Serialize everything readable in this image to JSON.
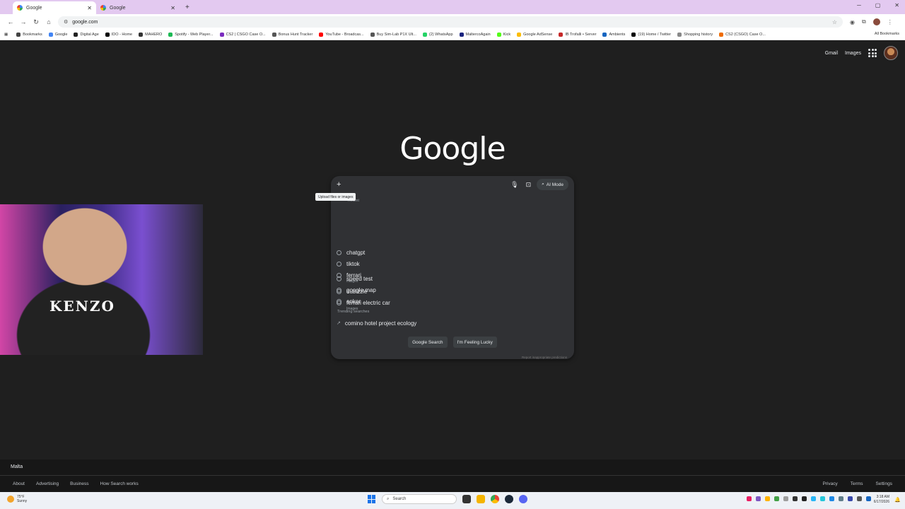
{
  "browser": {
    "tabs": [
      {
        "title": "Google",
        "active": true
      },
      {
        "title": "Google",
        "active": false
      }
    ],
    "url": "google.com",
    "bookmarks": [
      {
        "label": "Bookmarks",
        "color": "#444"
      },
      {
        "label": "Google",
        "color": "#4285f4"
      },
      {
        "label": "Digital Age",
        "color": "#222"
      },
      {
        "label": "IDO - Home",
        "color": "#000"
      },
      {
        "label": "MAHERO",
        "color": "#333"
      },
      {
        "label": "Spotify - Web Player...",
        "color": "#1db954"
      },
      {
        "label": "CS2 | CSGO Case O...",
        "color": "#7b2cbf"
      },
      {
        "label": "Bonus Hunt Tracker",
        "color": "#555"
      },
      {
        "label": "YouTube - Broadcas...",
        "color": "#ff0000"
      },
      {
        "label": "Buy Sim-Lab P1X Ult...",
        "color": "#555"
      },
      {
        "label": "(2) WhatsApp",
        "color": "#25d366"
      },
      {
        "label": "MaltercoAgain",
        "color": "#1a237e"
      },
      {
        "label": "Kick",
        "color": "#53fc18"
      },
      {
        "label": "Google AdSense",
        "color": "#fbbc05"
      },
      {
        "label": "IB Trofalli • Server",
        "color": "#c62828"
      },
      {
        "label": "Ambients",
        "color": "#1565c0"
      },
      {
        "label": "(19) Home / Twitter",
        "color": "#000"
      },
      {
        "label": "Shopping history",
        "color": "#888"
      },
      {
        "label": "CS2 (CSGO) Case O...",
        "color": "#ef6c00"
      }
    ],
    "all_bookmarks": "All Bookmarks"
  },
  "google": {
    "header_links": {
      "gmail": "Gmail",
      "images": "Images"
    },
    "logo": "Google",
    "search": {
      "value": "",
      "placeholder": ""
    },
    "ai_mode": "AI Mode",
    "tooltip": "Upload files or images",
    "recent_heading": "Recent",
    "suggestions": [
      {
        "text": "chatgpt",
        "sub": ""
      },
      {
        "text": "tiktok",
        "sub": ""
      },
      {
        "text": "ferrari",
        "sub": "Images"
      },
      {
        "text": "dubizzle",
        "sub": ""
      },
      {
        "text": "ferrari electric car",
        "sub": "Images"
      },
      {
        "text": "speed test",
        "sub": ""
      },
      {
        "text": "google map",
        "sub": ""
      },
      {
        "text": "anker",
        "sub": ""
      }
    ],
    "trending_heading": "Trending searches",
    "trending": [
      {
        "text": "comino hotel project ecology"
      }
    ],
    "buttons": {
      "search": "Google Search",
      "lucky": "I'm Feeling Lucky"
    },
    "report": "Report inappropriate predictions"
  },
  "webcam": {
    "shirt_text": "KENZO"
  },
  "footer": {
    "country": "Malta",
    "left_links": [
      "About",
      "Advertising",
      "Business",
      "How Search works"
    ],
    "right_links": [
      "Privacy",
      "Terms",
      "Settings"
    ]
  },
  "taskbar": {
    "weather_temp": "75°F",
    "weather_desc": "Sunny",
    "search_label": "Search",
    "time": "3:18 AM",
    "date": "6/17/2026",
    "apps": [
      {
        "name": "file-explorer",
        "color": "#f4b400"
      },
      {
        "name": "chrome",
        "color": "#4285f4"
      },
      {
        "name": "steam",
        "color": "#1b2838"
      },
      {
        "name": "discord",
        "color": "#5865f2"
      }
    ],
    "tray_colors": [
      "#e91e63",
      "#7e57c2",
      "#ffb300",
      "#43a047",
      "#9e9e9e",
      "#333",
      "#222",
      "#29b6f6",
      "#26c6da",
      "#1e88e5",
      "#607d8b",
      "#3949ab",
      "#555",
      "#1565c0"
    ]
  }
}
